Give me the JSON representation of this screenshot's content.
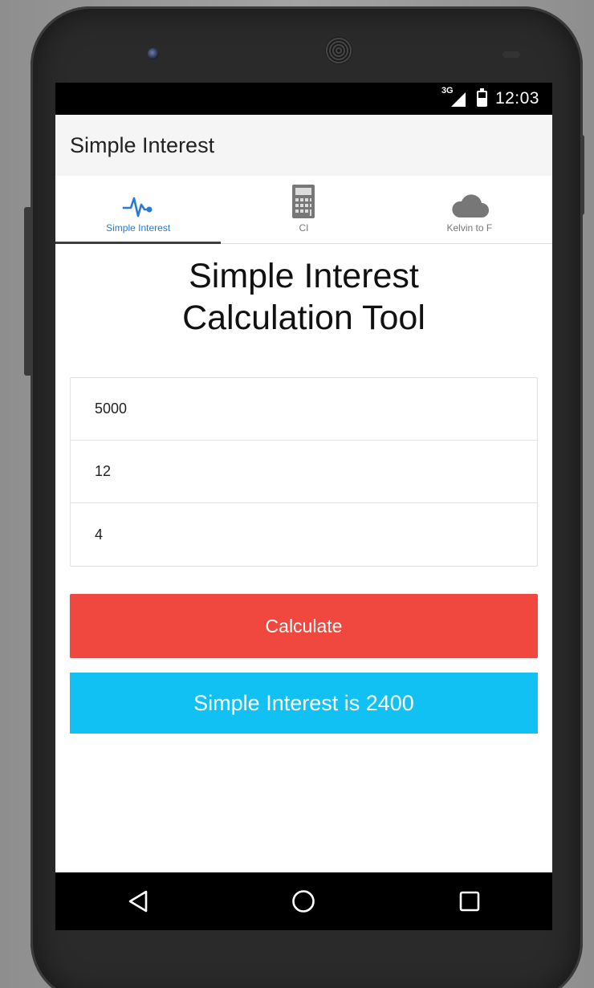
{
  "app": {
    "title": "Simple Interest"
  },
  "statusbar": {
    "network": "3G",
    "time": "12:03"
  },
  "tabs": [
    {
      "label": "Simple Interest",
      "icon": "pulse-icon",
      "active": true
    },
    {
      "label": "CI",
      "icon": "calculator-icon",
      "active": false
    },
    {
      "label": "Kelvin to F",
      "icon": "cloud-icon",
      "active": false
    }
  ],
  "main": {
    "heading_line1": "Simple Interest",
    "heading_line2": "Calculation Tool",
    "fields": [
      {
        "value": "5000"
      },
      {
        "value": "12"
      },
      {
        "value": "4"
      }
    ],
    "calculate_label": "Calculate",
    "result_text": "Simple Interest is 2400"
  },
  "navbar": {
    "back": "back-icon",
    "home": "home-icon",
    "recents": "recents-icon"
  },
  "colors": {
    "accent_tab": "#2979d6",
    "calculate_button": "#f0483e",
    "result_bar": "#11c1f3",
    "appbar": "#f5f5f5"
  }
}
